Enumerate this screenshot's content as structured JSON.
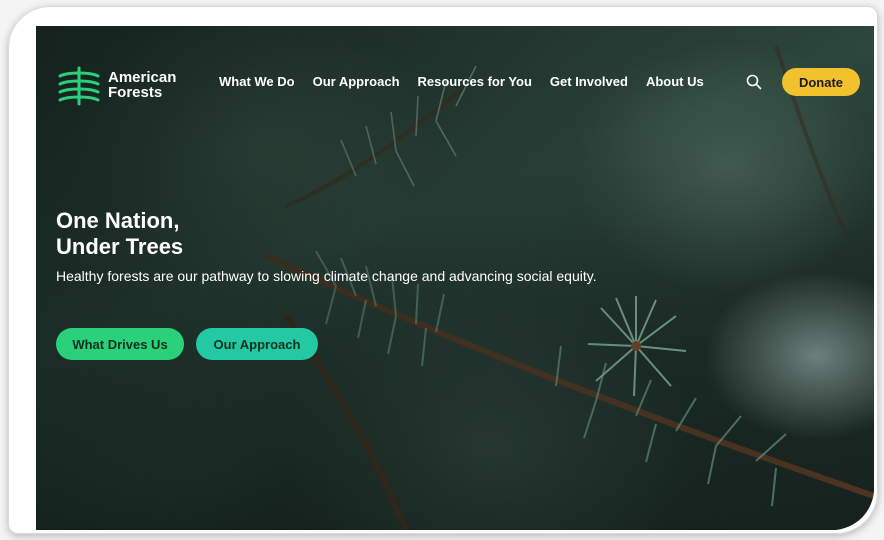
{
  "logo": {
    "line1": "American",
    "line2": "Forests",
    "mark_color": "#2bd07a"
  },
  "nav": {
    "items": [
      {
        "label": "What We Do"
      },
      {
        "label": "Our Approach"
      },
      {
        "label": "Resources for You"
      },
      {
        "label": "Get Involved"
      },
      {
        "label": "About Us"
      }
    ]
  },
  "header": {
    "search_icon": "search-icon",
    "donate_label": "Donate",
    "donate_color": "#f2c12e"
  },
  "hero": {
    "title_line1": "One Nation,",
    "title_line2": "Under Trees",
    "subtitle": "Healthy forests are our pathway to slowing climate change and advancing social equity.",
    "primary_button": "What Drives Us",
    "secondary_button": "Our Approach",
    "primary_color": "#2bd07a",
    "secondary_color": "#22c9a2"
  }
}
